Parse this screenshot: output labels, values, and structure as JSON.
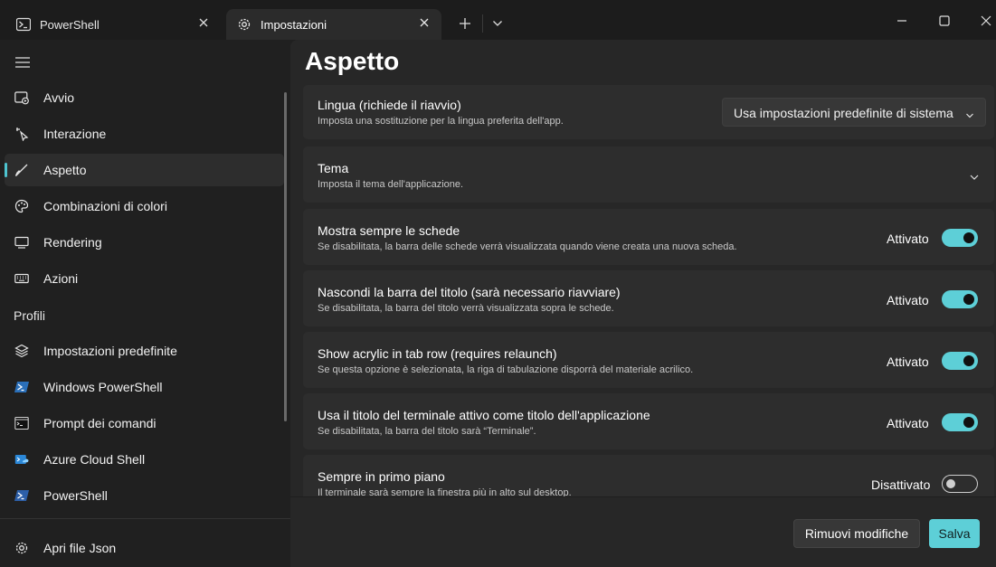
{
  "tabs": [
    {
      "label": "PowerShell",
      "icon": "powershell-icon"
    },
    {
      "label": "Impostazioni",
      "icon": "gear-icon"
    }
  ],
  "window_controls": [
    "new-tab-icon",
    "dropdown-icon",
    "minimize-icon",
    "maximize-icon",
    "close-icon"
  ],
  "sidebar": {
    "items": [
      {
        "label": "Avvio",
        "icon": "startup-icon"
      },
      {
        "label": "Interazione",
        "icon": "interaction-icon"
      },
      {
        "label": "Aspetto",
        "icon": "brush-icon",
        "selected": true
      },
      {
        "label": "Combinazioni di colori",
        "icon": "palette-icon"
      },
      {
        "label": "Rendering",
        "icon": "monitor-icon"
      },
      {
        "label": "Azioni",
        "icon": "keyboard-icon"
      }
    ],
    "profiles_header": "Profili",
    "profiles": [
      {
        "label": "Impostazioni predefinite",
        "icon": "layers-icon"
      },
      {
        "label": "Windows PowerShell",
        "icon": "powershell-icon"
      },
      {
        "label": "Prompt dei comandi",
        "icon": "cmd-icon"
      },
      {
        "label": "Azure Cloud Shell",
        "icon": "azure-icon"
      },
      {
        "label": "PowerShell",
        "icon": "powershell-icon"
      }
    ],
    "footer_item": {
      "label": "Apri file Json",
      "icon": "gear-icon"
    }
  },
  "main": {
    "title": "Aspetto",
    "settings": [
      {
        "title": "Lingua (richiede il riavvio)",
        "subtitle": "Imposta una sostituzione per la lingua preferita dell'app.",
        "control": "dropdown",
        "value": "Usa impostazioni predefinite di sistema"
      },
      {
        "title": "Tema",
        "subtitle": "Imposta il tema dell'applicazione.",
        "control": "expander"
      },
      {
        "title": "Mostra sempre le schede",
        "subtitle": "Se disabilitata, la barra delle schede verrà visualizzata quando viene creata una nuova scheda.",
        "control": "toggle",
        "state": true,
        "state_label": "Attivato"
      },
      {
        "title": "Nascondi la barra del titolo (sarà necessario riavviare)",
        "subtitle": "Se disabilitata, la barra del titolo verrà visualizzata sopra le schede.",
        "control": "toggle",
        "state": true,
        "state_label": "Attivato"
      },
      {
        "title": "Show acrylic in tab row (requires relaunch)",
        "subtitle": "Se questa opzione è selezionata, la riga di tabulazione disporrà del materiale acrilico.",
        "control": "toggle",
        "state": true,
        "state_label": "Attivato"
      },
      {
        "title": "Usa il titolo del terminale attivo come titolo dell'applicazione",
        "subtitle": "Se disabilitata, la barra del titolo sarà “Terminale”.",
        "control": "toggle",
        "state": true,
        "state_label": "Attivato"
      },
      {
        "title": "Sempre in primo piano",
        "subtitle": "Il terminale sarà sempre la finestra più in alto sul desktop.",
        "control": "toggle",
        "state": false,
        "state_label": "Disattivato"
      }
    ],
    "buttons": {
      "discard": "Rimuovi modifiche",
      "save": "Salva"
    }
  },
  "colors": {
    "accent": "#5dcfd7",
    "background": "#202020",
    "card": "#2d2d2d"
  }
}
